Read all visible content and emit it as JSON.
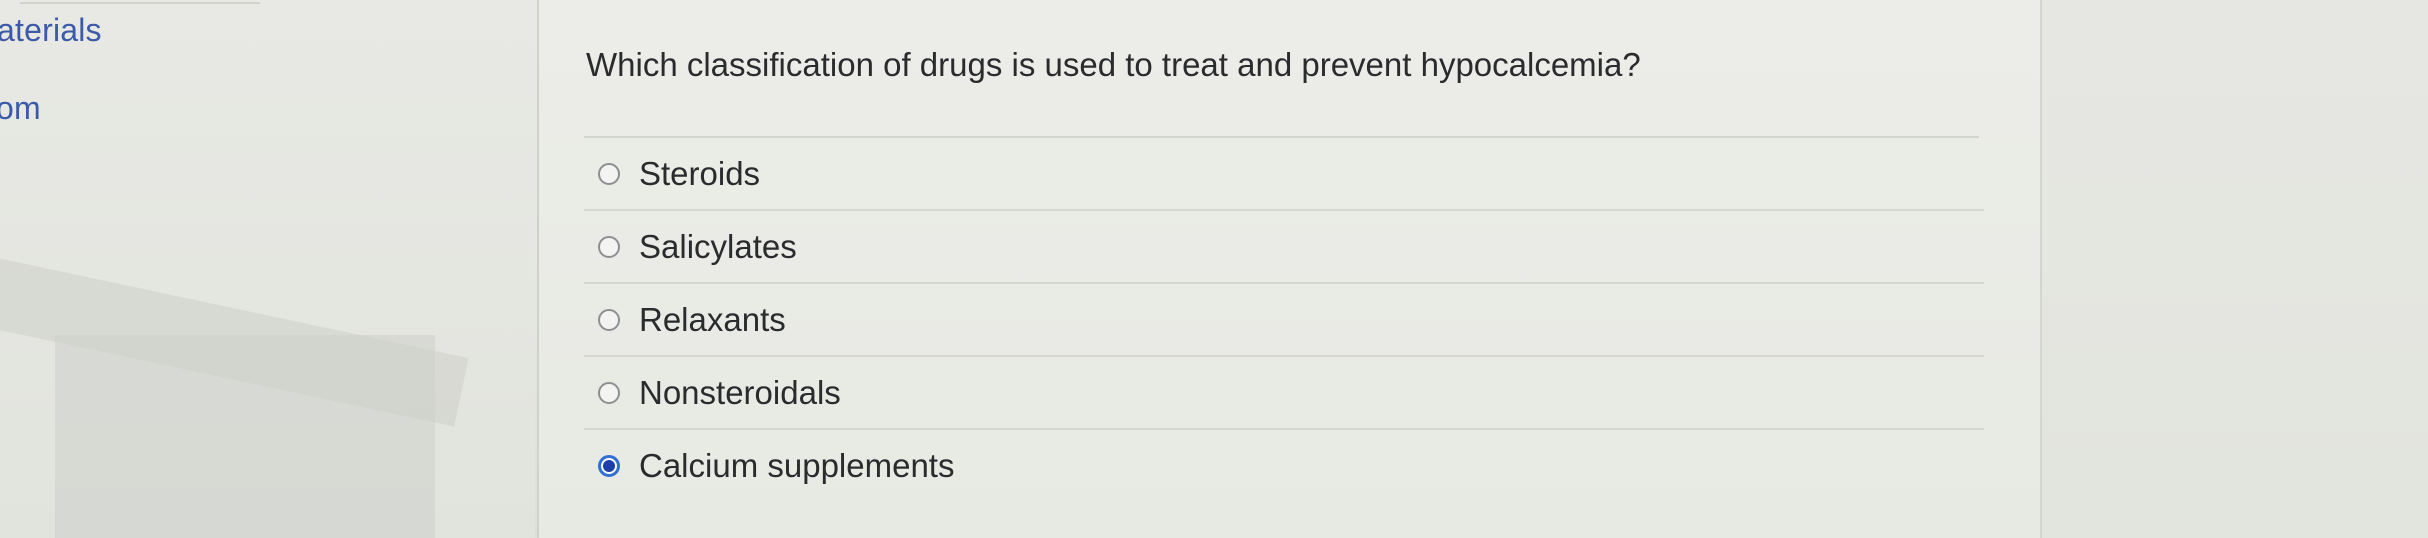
{
  "sidebar": {
    "items": [
      {
        "label": "aterials"
      },
      {
        "label": "oom"
      }
    ]
  },
  "question": {
    "text": "Which classification of drugs is used to treat and prevent hypocalcemia?",
    "options": [
      {
        "label": "Steroids",
        "selected": false
      },
      {
        "label": "Salicylates",
        "selected": false
      },
      {
        "label": "Relaxants",
        "selected": false
      },
      {
        "label": "Nonsteroidals",
        "selected": false
      },
      {
        "label": "Calcium supplements",
        "selected": true
      }
    ]
  },
  "colors": {
    "link": "#3b5aa8",
    "radio_selected": "#2f6fd6",
    "text": "#2a2b2d"
  }
}
